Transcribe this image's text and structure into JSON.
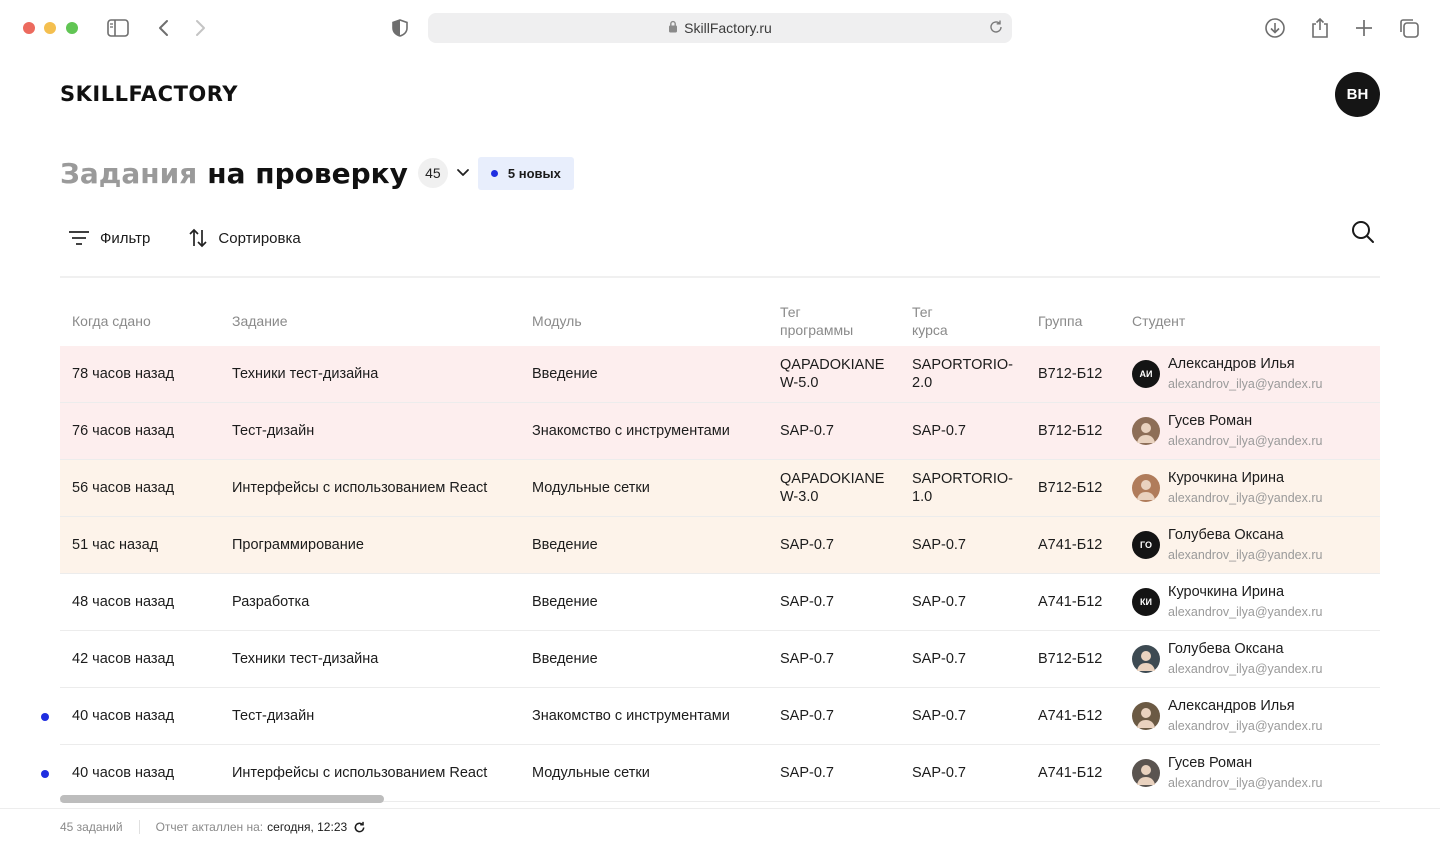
{
  "browser": {
    "url": "SkillFactory.ru"
  },
  "header": {
    "logo": "SKILLFACTORY",
    "user_initials": "BH"
  },
  "page": {
    "title_part1": "Задания",
    "title_part2": "на проверку",
    "count": "45",
    "new_badge": "5 новых"
  },
  "toolbar": {
    "filter_label": "Фильтр",
    "sort_label": "Сортировка"
  },
  "table": {
    "headers": {
      "when": "Когда сдано",
      "task": "Задание",
      "module": "Модуль",
      "program_tag_l1": "Тег",
      "program_tag_l2": "программы",
      "course_tag_l1": "Тег",
      "course_tag_l2": "курса",
      "group": "Группа",
      "student": "Студент"
    },
    "rows": [
      {
        "when": "78 часов назад",
        "task": "Техники тест-дизайна",
        "module": "Введение",
        "program_tag_l1": "QAPADOKIANE",
        "program_tag_l2": "W-5.0",
        "course_tag_l1": "SAPORTORIO-",
        "course_tag_l2": "2.0",
        "group": "B712-Б12",
        "student": "Александров Илья",
        "email": "alexandrov_ilya@yandex.ru",
        "initials": "АИ"
      },
      {
        "when": "76 часов назад",
        "task": "Тест-дизайн",
        "module": "Знакомство с инструментами",
        "program_tag_l1": "SAP-0.7",
        "program_tag_l2": "",
        "course_tag_l1": "SAP-0.7",
        "course_tag_l2": "",
        "group": "B712-Б12",
        "student": "Гусев Роман",
        "email": "alexandrov_ilya@yandex.ru",
        "initials": ""
      },
      {
        "when": "56 часов назад",
        "task": "Интерфейсы с использованием React",
        "module": "Модульные сетки",
        "program_tag_l1": "QAPADOKIANE",
        "program_tag_l2": "W-3.0",
        "course_tag_l1": "SAPORTORIO-",
        "course_tag_l2": "1.0",
        "group": "B712-Б12",
        "student": "Курочкина Ирина",
        "email": "alexandrov_ilya@yandex.ru",
        "initials": ""
      },
      {
        "when": "51 час назад",
        "task": "Программирование",
        "module": "Введение",
        "program_tag_l1": "SAP-0.7",
        "program_tag_l2": "",
        "course_tag_l1": "SAP-0.7",
        "course_tag_l2": "",
        "group": "A741-Б12",
        "student": "Голубева Оксана",
        "email": "alexandrov_ilya@yandex.ru",
        "initials": "ГО"
      },
      {
        "when": "48 часов назад",
        "task": "Разработка",
        "module": "Введение",
        "program_tag_l1": "SAP-0.7",
        "program_tag_l2": "",
        "course_tag_l1": "SAP-0.7",
        "course_tag_l2": "",
        "group": "A741-Б12",
        "student": "Курочкина Ирина",
        "email": "alexandrov_ilya@yandex.ru",
        "initials": "КИ"
      },
      {
        "when": "42 часов назад",
        "task": "Техники тест-дизайна",
        "module": "Введение",
        "program_tag_l1": "SAP-0.7",
        "program_tag_l2": "",
        "course_tag_l1": "SAP-0.7",
        "course_tag_l2": "",
        "group": "B712-Б12",
        "student": "Голубева Оксана",
        "email": "alexandrov_ilya@yandex.ru",
        "initials": ""
      },
      {
        "when": "40 часов назад",
        "task": "Тест-дизайн",
        "module": "Знакомство с инструментами",
        "program_tag_l1": "SAP-0.7",
        "program_tag_l2": "",
        "course_tag_l1": "SAP-0.7",
        "course_tag_l2": "",
        "group": "A741-Б12",
        "student": "Александров Илья",
        "email": "alexandrov_ilya@yandex.ru",
        "initials": ""
      },
      {
        "when": "40 часов назад",
        "task": "Интерфейсы с использованием React",
        "module": "Модульные сетки",
        "program_tag_l1": "SAP-0.7",
        "program_tag_l2": "",
        "course_tag_l1": "SAP-0.7",
        "course_tag_l2": "",
        "group": "A741-Б12",
        "student": "Гусев Роман",
        "email": "alexandrov_ilya@yandex.ru",
        "initials": ""
      }
    ]
  },
  "footer": {
    "total": "45 заданий",
    "report_label": "Отчет акталлен на:",
    "report_value": "сегодня, 12:23"
  },
  "colors": {
    "accent": "#1f2ee0",
    "row_red": "#fdeeee",
    "row_orange": "#fdf3ea"
  }
}
